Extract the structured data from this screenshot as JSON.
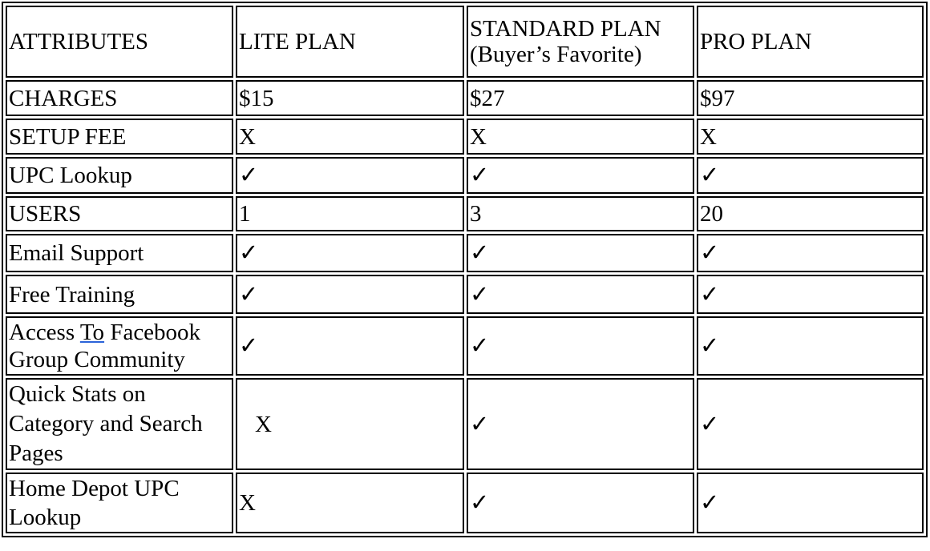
{
  "headers": [
    "ATTRIBUTES",
    "LITE PLAN",
    "STANDARD PLAN",
    "PRO PLAN"
  ],
  "standard_subtitle": "(Buyer’s Favorite)",
  "rows": [
    {
      "attr": "CHARGES",
      "lite": "$15",
      "standard": "$27",
      "pro": "$97"
    },
    {
      "attr": "SETUP FEE",
      "lite": "X",
      "standard": "X",
      "pro": "X"
    },
    {
      "attr": "UPC Lookup",
      "lite": "✓",
      "standard": "✓",
      "pro": "✓"
    },
    {
      "attr": "USERS",
      "lite": "1",
      "standard": "3",
      "pro": "20"
    },
    {
      "attr": "Email Support",
      "lite": "✓",
      "standard": "✓",
      "pro": "✓"
    },
    {
      "attr": "Free Training",
      "lite": "✓",
      "standard": "✓",
      "pro": "✓"
    },
    {
      "attr_parts": [
        "Access ",
        "To",
        " Facebook Group Community"
      ],
      "lite": "✓",
      "standard": "✓",
      "pro": "✓"
    },
    {
      "attr": "Quick Stats on Category and Search Pages",
      "lite": "X",
      "standard": "✓",
      "pro": "✓"
    },
    {
      "attr": "Home Depot UPC Lookup",
      "lite": "X",
      "standard": "✓",
      "pro": "✓"
    }
  ],
  "colors": {
    "border": "#000000",
    "spellcheck_underline": "#2b63d9"
  }
}
